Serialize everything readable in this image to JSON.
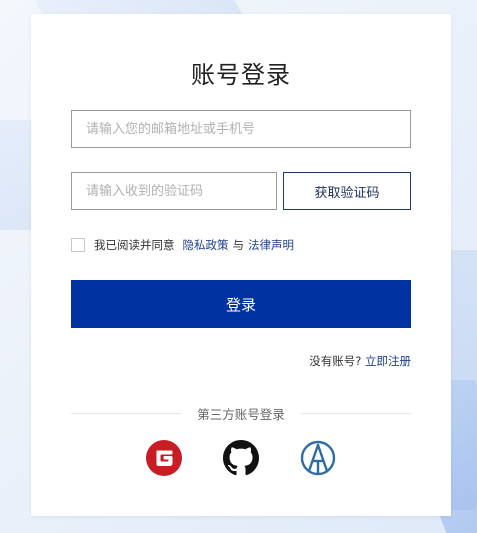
{
  "login": {
    "title": "账号登录",
    "email_placeholder": "请输入您的邮箱地址或手机号",
    "code_placeholder": "请输入收到的验证码",
    "get_code_label": "获取验证码",
    "agree_text": "我已阅读并同意",
    "privacy_link": "隐私政策",
    "and_text": "与",
    "legal_link": "法律声明",
    "login_label": "登录",
    "no_account_text": "没有账号?",
    "register_link": "立即注册",
    "third_party_label": "第三方账号登录"
  },
  "social": [
    {
      "name": "gitee-icon",
      "color": "#c71d23"
    },
    {
      "name": "github-icon",
      "color": "#111111"
    },
    {
      "name": "atomgit-icon",
      "color": "#2d6da3"
    }
  ],
  "colors": {
    "primary": "#0033a1",
    "link": "#1d3f8a",
    "border": "#9a9a9a"
  }
}
